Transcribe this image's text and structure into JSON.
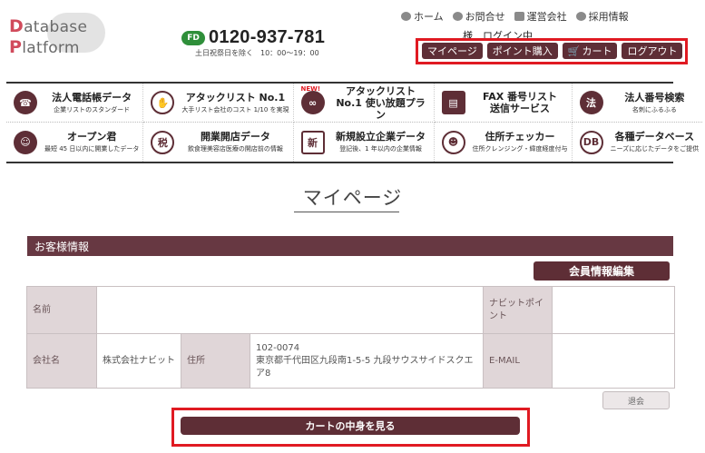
{
  "logo": {
    "line1_cap": "D",
    "line1_rest": "atabase",
    "line2_cap": "P",
    "line2_rest": "latform"
  },
  "phone": {
    "badge": "FD",
    "number": "0120-937-781",
    "hours": "土日祝祭日を除く　10：00～19：00"
  },
  "topnav": [
    {
      "label": "ホーム",
      "icon": "home-icon"
    },
    {
      "label": "お問合せ",
      "icon": "chat-icon"
    },
    {
      "label": "運営会社",
      "icon": "folder-icon"
    },
    {
      "label": "採用情報",
      "icon": "person-icon"
    }
  ],
  "login_status": "様　ログイン中",
  "account_buttons": {
    "mypage": "マイページ",
    "buy_points": "ポイント購入",
    "cart": "カート",
    "logout": "ログアウト"
  },
  "services": [
    {
      "title": "法人電話帳データ",
      "sub": "企業リストのスタンダード",
      "icon": "phonebook-icon"
    },
    {
      "title": "アタックリスト No.1",
      "sub": "大手リスト会社のコスト 1/10 を実現",
      "icon": "handshake-icon"
    },
    {
      "title": "アタックリスト No.1 使い放題プラン",
      "sub": "",
      "icon": "infinity-icon",
      "badge": "NEW!"
    },
    {
      "title": "FAX 番号リスト 送信サービス",
      "sub": "",
      "icon": "fax-icon"
    },
    {
      "title": "法人番号検索",
      "sub": "名刺にふるふる",
      "icon": "corp-number-icon"
    },
    {
      "title": "オープン君",
      "sub": "最短 45 日以内に開業したデータ",
      "icon": "mascot-icon"
    },
    {
      "title": "開業開店データ",
      "sub": "飲食理美容店医療の開店前の情報",
      "icon": "tax-icon"
    },
    {
      "title": "新規設立企業データ",
      "sub": "登記後、1 年以内の企業情報",
      "icon": "newspaper-icon"
    },
    {
      "title": "住所チェッカー",
      "sub": "住所クレンジング・緯度経度付与",
      "icon": "face-icon"
    },
    {
      "title": "各種データベース",
      "sub": "ニーズに応じたデータをご提供",
      "icon": "database-icon"
    }
  ],
  "page_title": "マイページ",
  "customer_section": {
    "header": "お客様情報",
    "edit_button": "会員情報編集",
    "labels": {
      "name": "名前",
      "points": "ナビットポイント",
      "company": "会社名",
      "address": "住所",
      "email": "E-MAIL"
    },
    "values": {
      "name": "",
      "points": "",
      "company": "株式会社ナビット",
      "postal": "102-0074",
      "address": "東京都千代田区九段南1-5-5 九段サウスサイドスクエア8",
      "email": ""
    }
  },
  "withdraw_button": "退会",
  "view_cart_button": "カートの中身を見る"
}
